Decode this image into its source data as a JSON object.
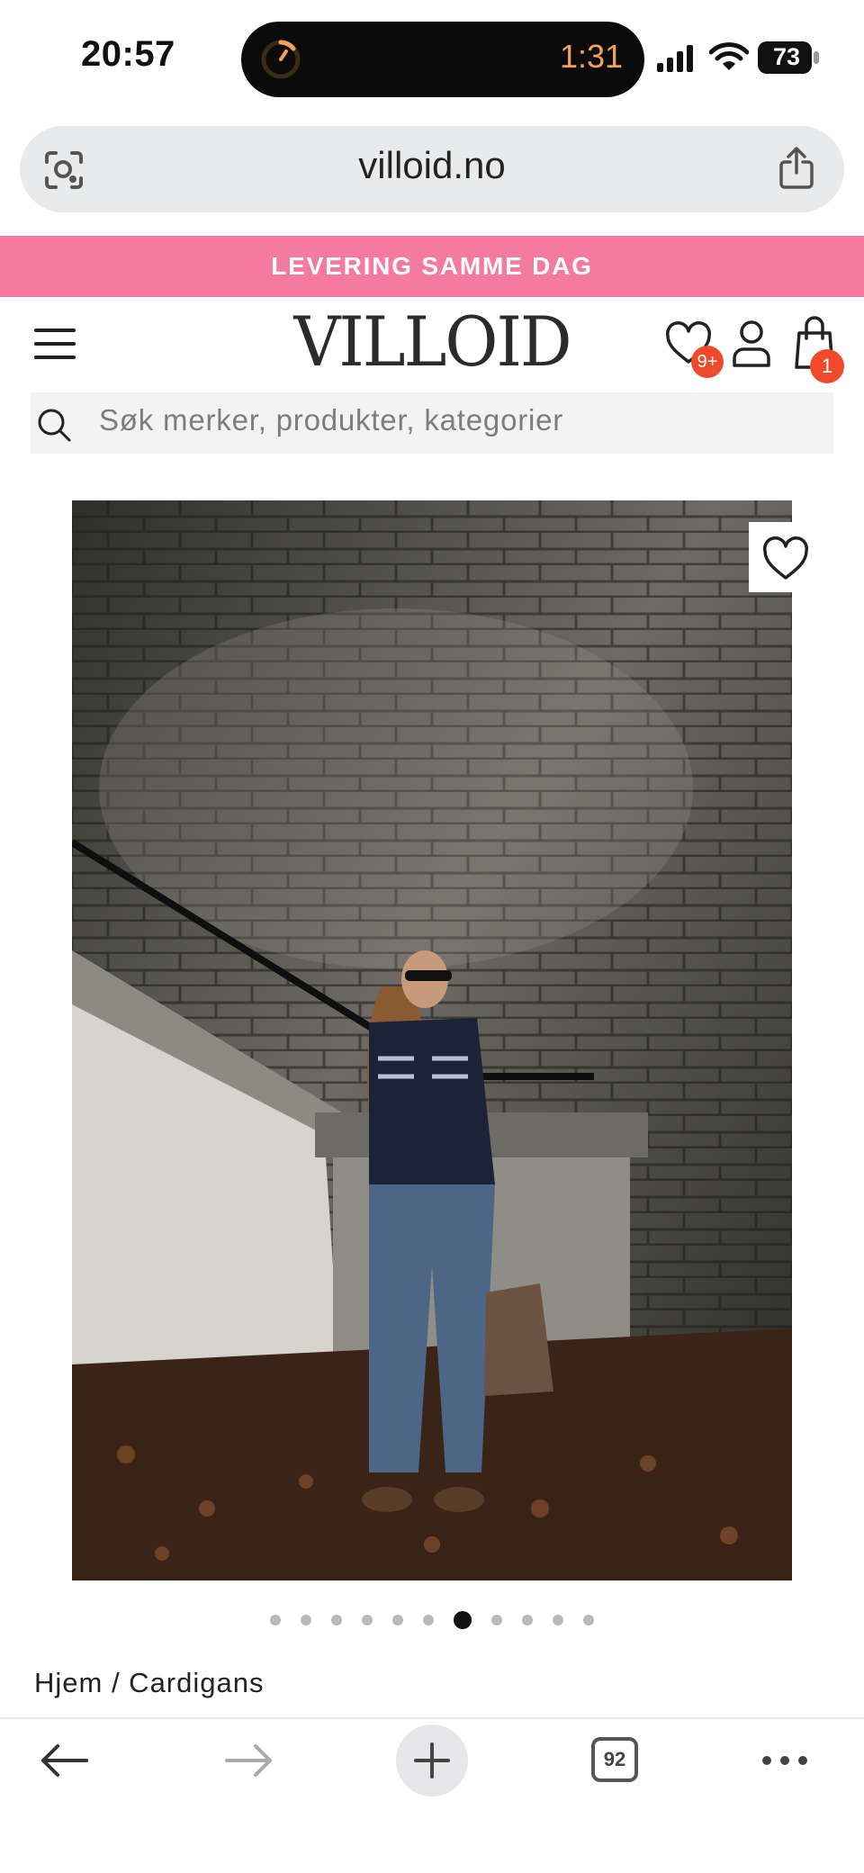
{
  "status_bar": {
    "time": "20:57",
    "island_timer": "1:31",
    "battery": "73"
  },
  "browser": {
    "url": "villoid.no",
    "tab_count": "92"
  },
  "banner": {
    "text": "LEVERING SAMME DAG"
  },
  "header": {
    "logo": "VILLOID",
    "favorites_badge": "9+",
    "bag_badge": "1"
  },
  "search": {
    "placeholder": "Søk merker, produkter, kategorier"
  },
  "carousel": {
    "total": 11,
    "active_index": 6
  },
  "breadcrumb": {
    "text": "Hjem / Cardigans"
  },
  "colors": {
    "banner": "#f47b9f",
    "badge": "#f04a2c",
    "island_timer": "#f2a357"
  },
  "icons": [
    "lens-icon",
    "share-icon",
    "menu-icon",
    "heart-icon",
    "user-icon",
    "bag-icon",
    "search-icon",
    "back-icon",
    "forward-icon",
    "plus-icon",
    "more-icon"
  ]
}
